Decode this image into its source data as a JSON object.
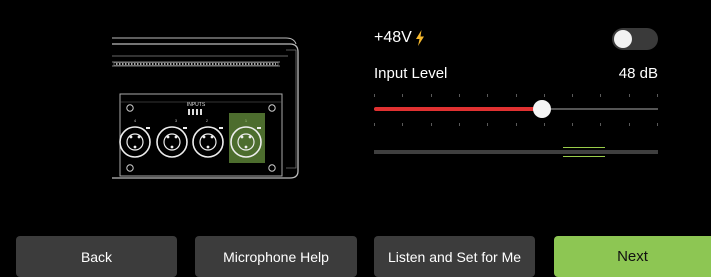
{
  "device": {
    "inputs_label": "INPUTS",
    "channel_numbers": [
      "4",
      "3",
      "2",
      "1"
    ],
    "selected_channel": "1"
  },
  "phantom": {
    "label": "+48V",
    "icon": "lightning-bolt-icon",
    "enabled": false
  },
  "input_level": {
    "label": "Input Level",
    "value": "48 dB",
    "slider_fraction": 0.59,
    "meter_peak_fraction": 0.74
  },
  "buttons": {
    "back": "Back",
    "help": "Microphone Help",
    "auto": "Listen and Set for Me",
    "next": "Next"
  },
  "colors": {
    "accent_green": "#8dc653",
    "level_red": "#e03131",
    "bolt_yellow": "#f5b82e"
  }
}
